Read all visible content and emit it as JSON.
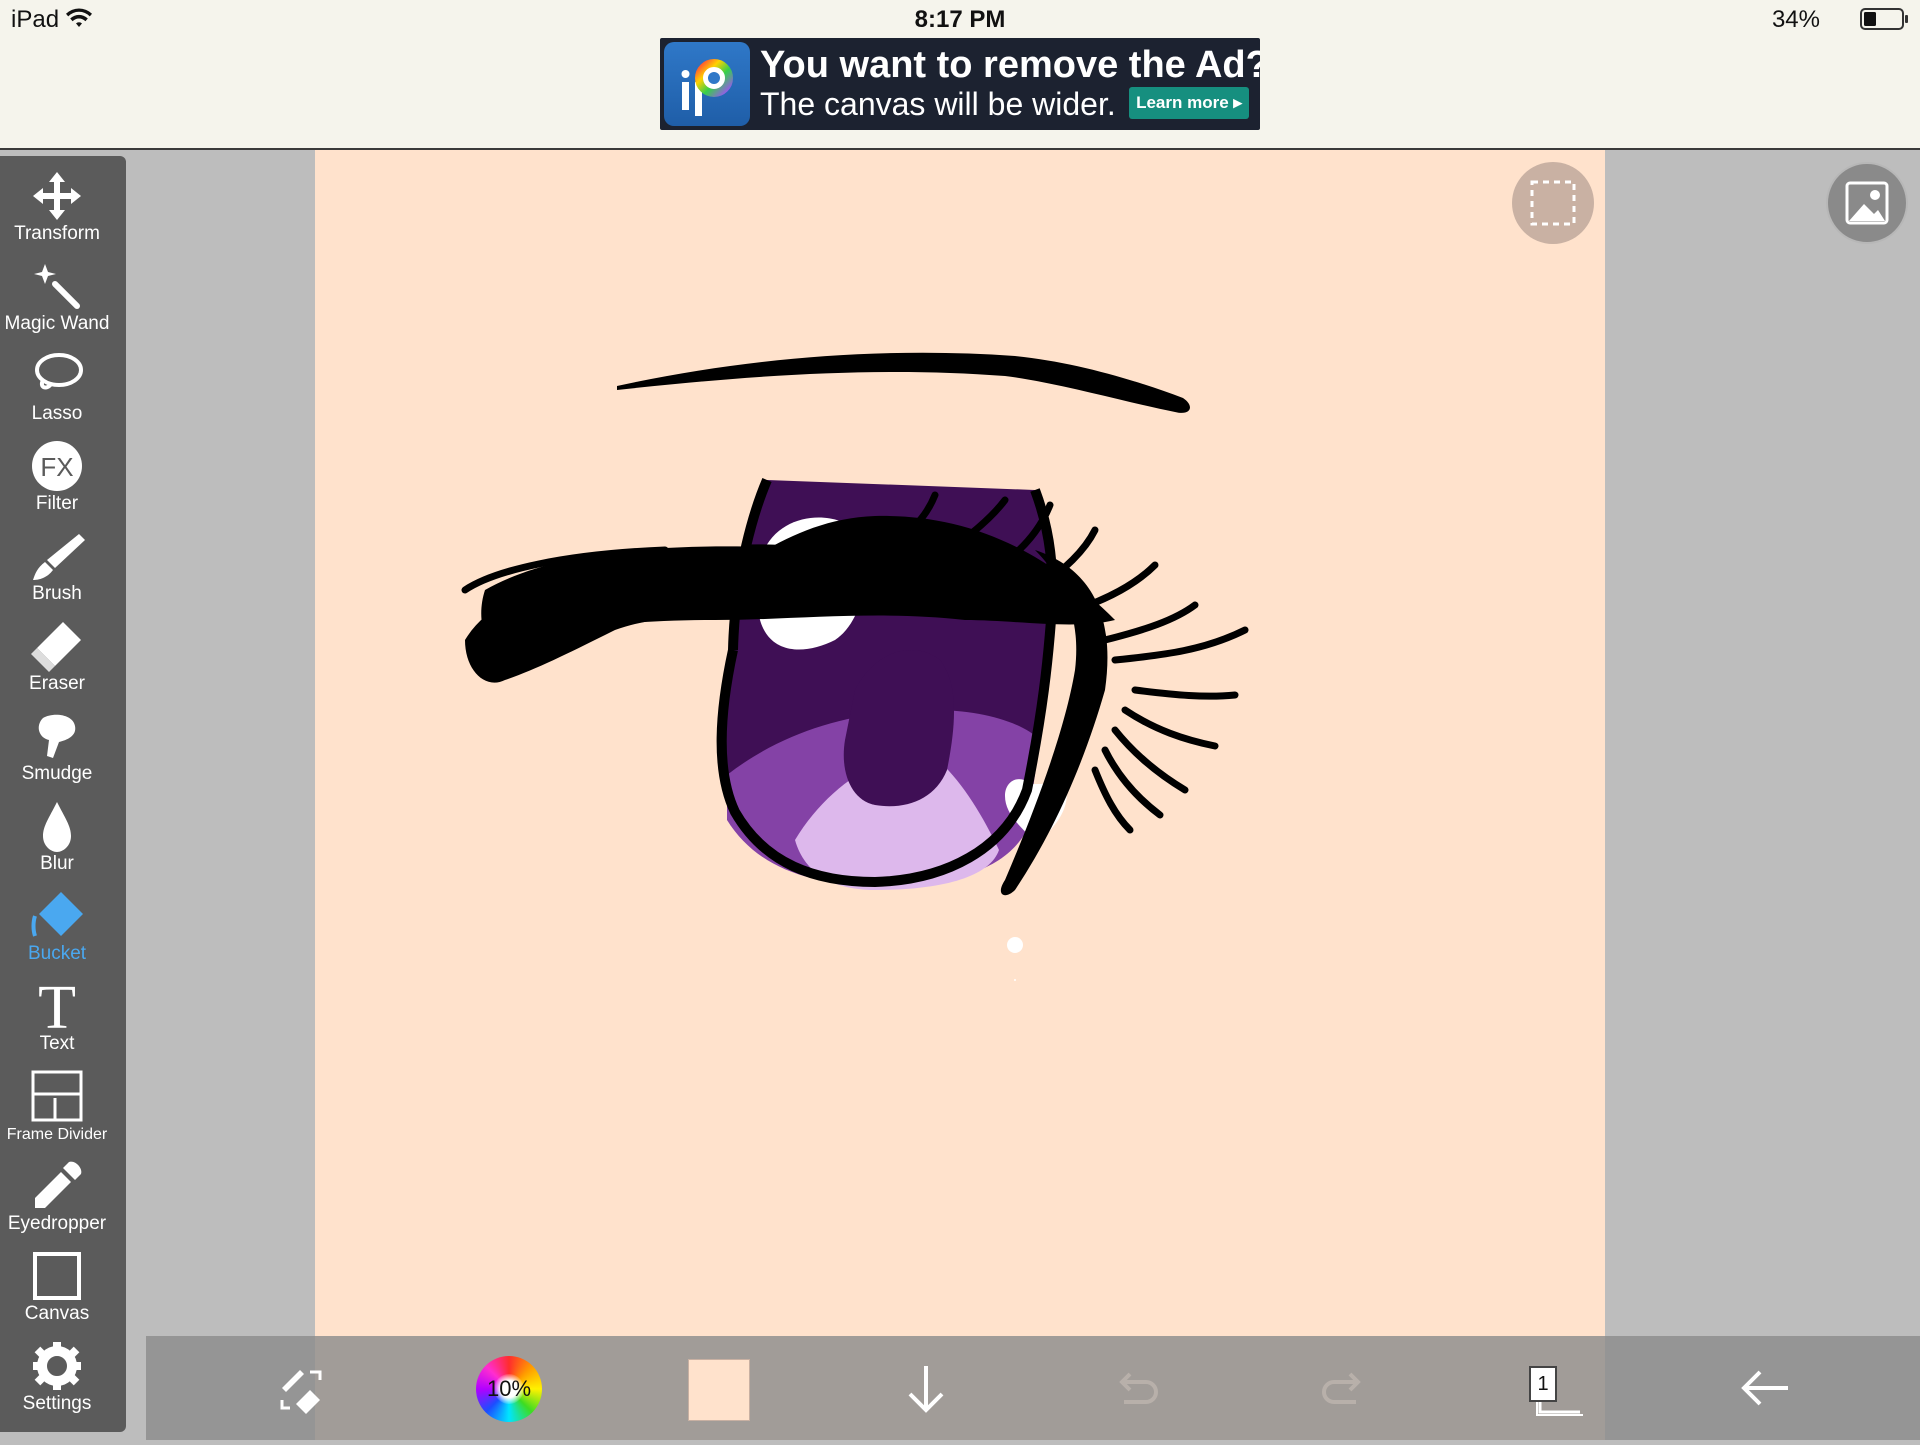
{
  "status_bar": {
    "device": "iPad",
    "time": "8:17 PM",
    "battery_percent": "34%",
    "battery_level": 0.34
  },
  "ad": {
    "headline": "You want to remove the Ad?",
    "subline": "The canvas will be wider.",
    "cta": "Learn more",
    "logo_icon": "ibispaint-logo-icon"
  },
  "tools": [
    {
      "label": "Transform",
      "icon": "transform-icon"
    },
    {
      "label": "Magic Wand",
      "icon": "magic-wand-icon"
    },
    {
      "label": "Lasso",
      "icon": "lasso-icon"
    },
    {
      "label": "Filter",
      "icon": "filter-fx-icon",
      "glyph": "FX"
    },
    {
      "label": "Brush",
      "icon": "brush-icon"
    },
    {
      "label": "Eraser",
      "icon": "eraser-icon"
    },
    {
      "label": "Smudge",
      "icon": "smudge-icon"
    },
    {
      "label": "Blur",
      "icon": "blur-drop-icon"
    },
    {
      "label": "Bucket",
      "icon": "bucket-icon"
    },
    {
      "label": "Text",
      "icon": "text-icon",
      "glyph": "T"
    },
    {
      "label": "Frame Divider",
      "icon": "frame-divider-icon"
    },
    {
      "label": "Eyedropper",
      "icon": "eyedropper-icon"
    },
    {
      "label": "Canvas",
      "icon": "canvas-icon"
    },
    {
      "label": "Settings",
      "icon": "gear-icon"
    }
  ],
  "active_tool": "Bucket",
  "bottom_bar": {
    "brush_size": "10%",
    "current_color": "#ffe2cc",
    "layer_count": "1"
  },
  "colors": {
    "accent": "#4aa8f0",
    "canvas_background": "#ffe2cc",
    "iris_dark": "#3f0f55",
    "iris_mid": "#8442a6",
    "iris_light": "#ddb8ec"
  }
}
